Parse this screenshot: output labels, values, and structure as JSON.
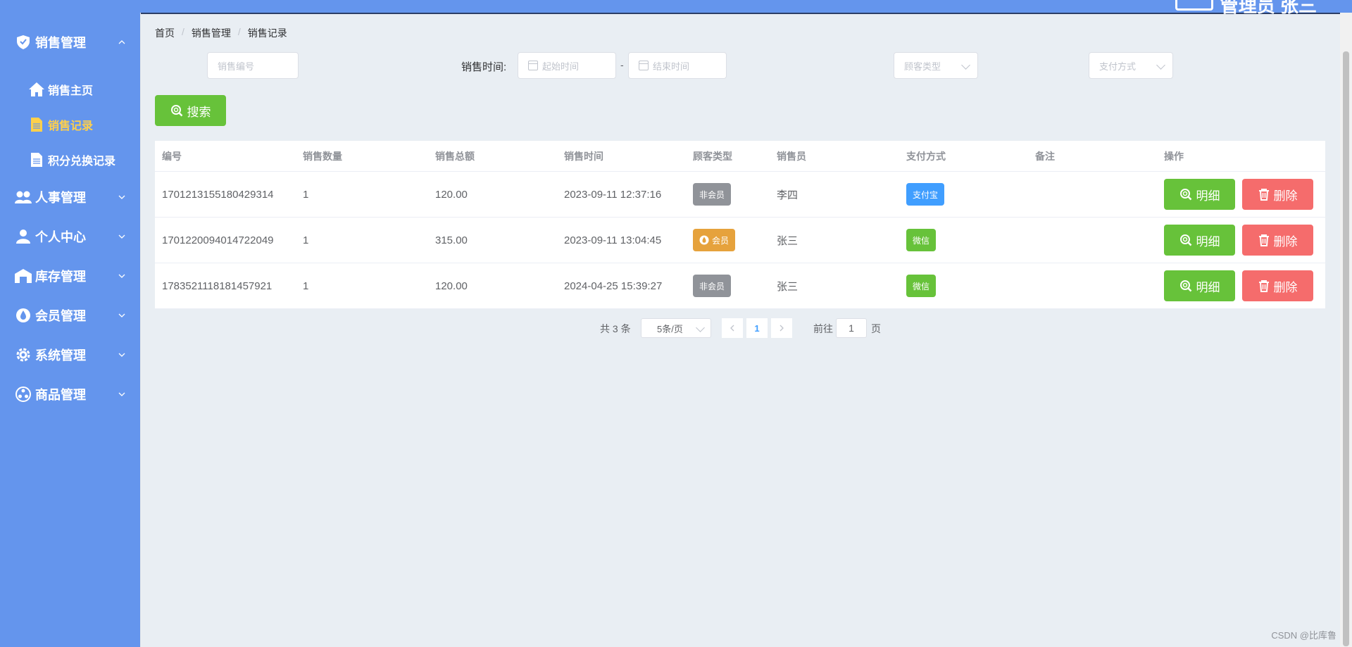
{
  "header": {
    "user_text": "管理员 张三"
  },
  "sidebar": {
    "groups": [
      {
        "label": "销售管理",
        "icon": "shield-icon",
        "expanded": true,
        "children": [
          {
            "label": "销售主页",
            "icon": "home-icon",
            "active": false
          },
          {
            "label": "销售记录",
            "icon": "document-icon",
            "active": true
          },
          {
            "label": "积分兑换记录",
            "icon": "document-icon",
            "active": false
          }
        ]
      },
      {
        "label": "人事管理",
        "icon": "people-icon"
      },
      {
        "label": "个人中心",
        "icon": "user-icon"
      },
      {
        "label": "库存管理",
        "icon": "warehouse-icon"
      },
      {
        "label": "会员管理",
        "icon": "drop-icon"
      },
      {
        "label": "系统管理",
        "icon": "gear-icon"
      },
      {
        "label": "商品管理",
        "icon": "goods-icon"
      }
    ]
  },
  "breadcrumb": [
    "首页",
    "销售管理",
    "销售记录"
  ],
  "filters": {
    "sale_no_placeholder": "销售编号",
    "time_label": "销售时间:",
    "start_placeholder": "起始时间",
    "end_placeholder": "结束时间",
    "dash": "-",
    "customer_type_placeholder": "顾客类型",
    "payment_placeholder": "支付方式",
    "search_label": "搜索"
  },
  "table": {
    "headers": [
      "编号",
      "销售数量",
      "销售总额",
      "销售时间",
      "顾客类型",
      "销售员",
      "支付方式",
      "备注",
      "操作"
    ],
    "rows": [
      {
        "id": "1701213155180429314",
        "qty": "1",
        "total": "120.00",
        "time": "2023-09-11 12:37:16",
        "customer_type": "非会员",
        "seller": "李四",
        "payment": "支付宝",
        "note": ""
      },
      {
        "id": "1701220094014722049",
        "qty": "1",
        "total": "315.00",
        "time": "2023-09-11 13:04:45",
        "customer_type": "会员",
        "seller": "张三",
        "payment": "微信",
        "note": ""
      },
      {
        "id": "1783521118181457921",
        "qty": "1",
        "total": "120.00",
        "time": "2024-04-25 15:39:27",
        "customer_type": "非会员",
        "seller": "张三",
        "payment": "微信",
        "note": ""
      }
    ],
    "detail_label": "明细",
    "delete_label": "删除"
  },
  "pagination": {
    "total": "共 3 条",
    "page_size": "5条/页",
    "current": "1",
    "goto_prefix": "前往",
    "goto_value": "1",
    "goto_suffix": "页"
  },
  "watermark": "CSDN @比库鲁",
  "colors": {
    "sidebar": "#6495ed",
    "active": "#ffd04b",
    "success": "#67c23a",
    "danger": "#f56c6c",
    "warning": "#e6a23c",
    "primary": "#409eff",
    "info": "#909399"
  }
}
